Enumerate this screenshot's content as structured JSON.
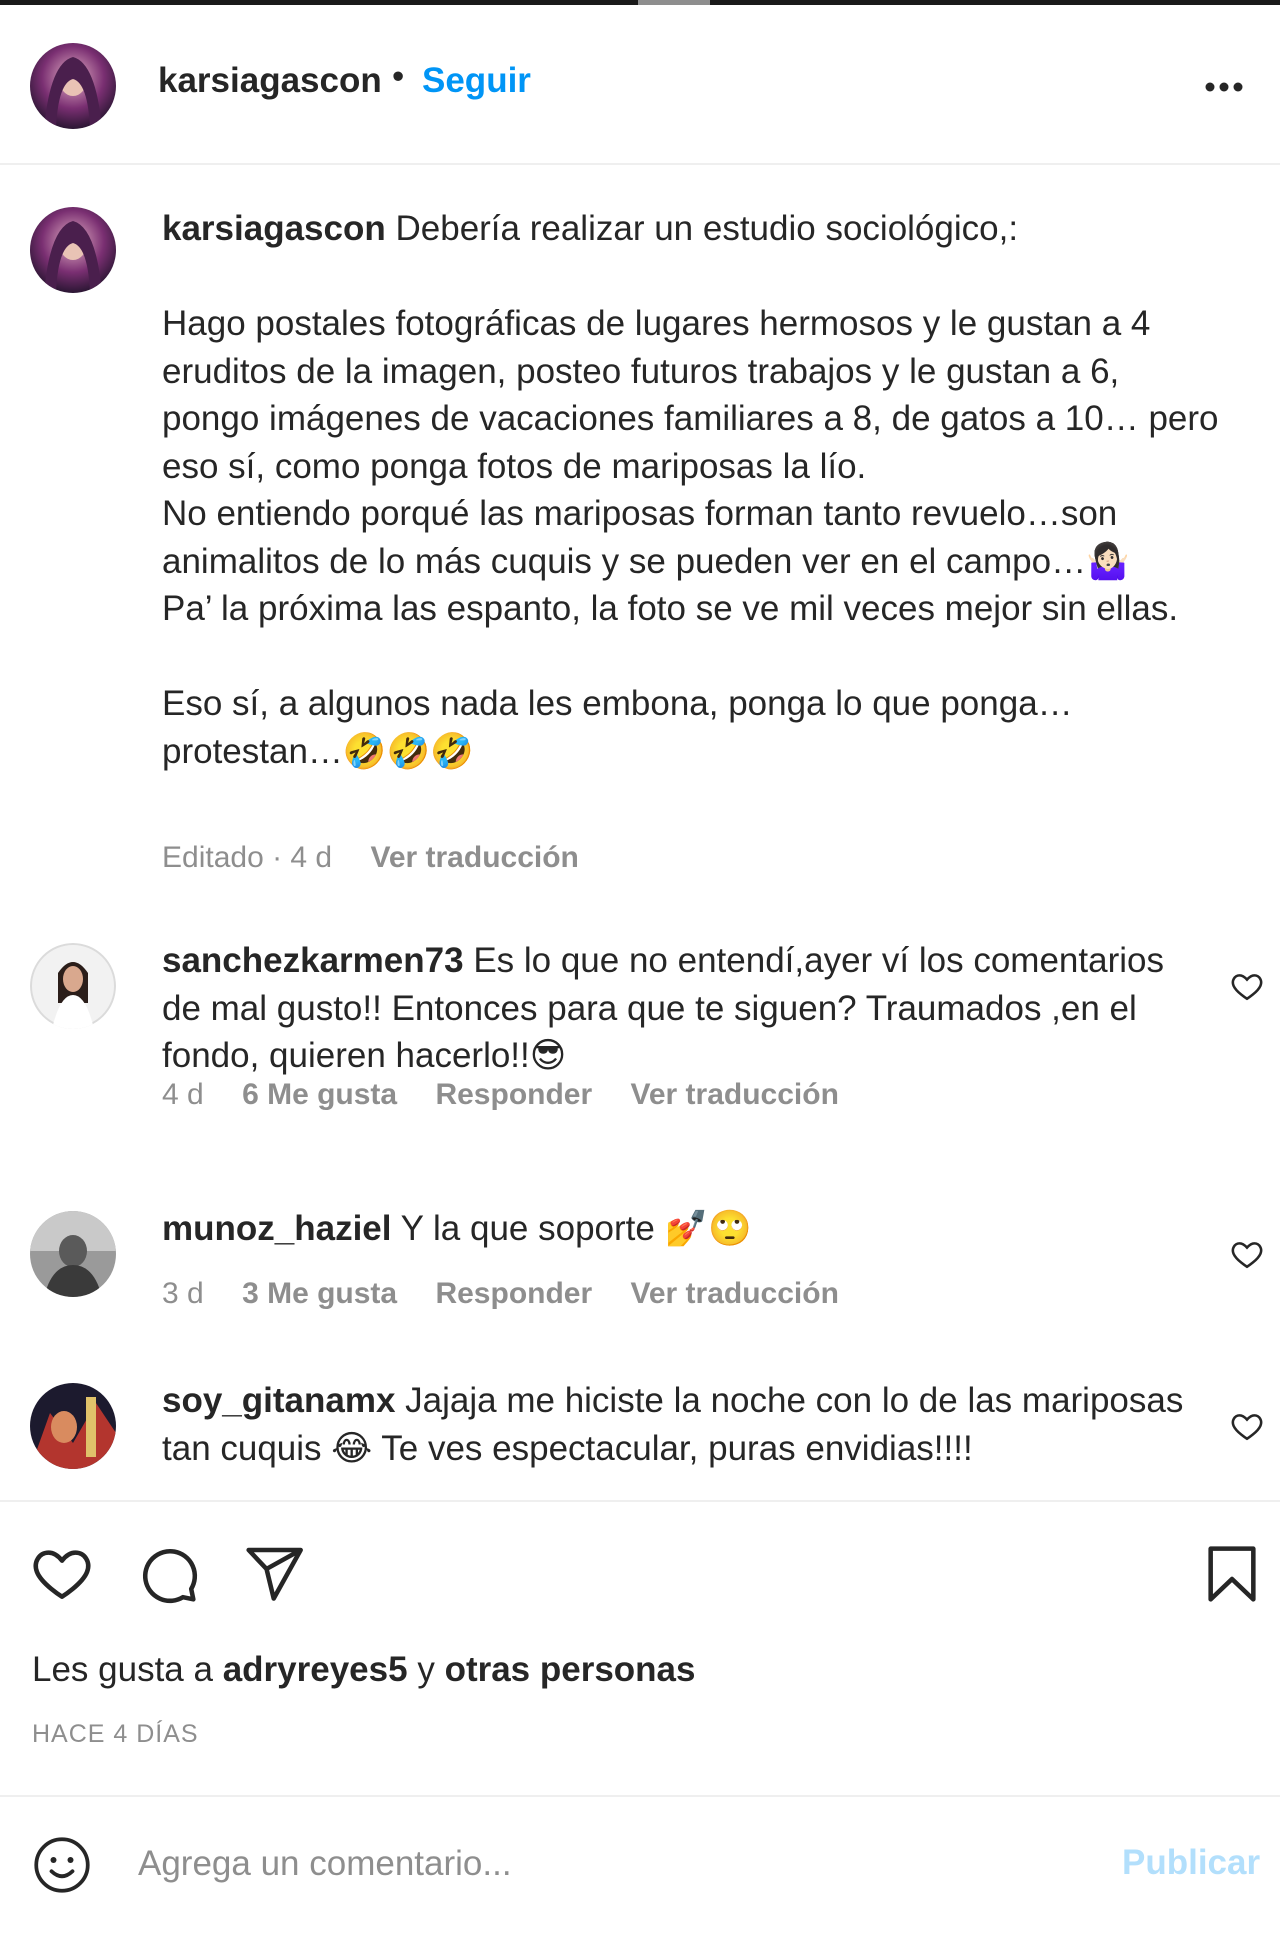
{
  "header": {
    "username": "karsiagascon",
    "separator": "•",
    "follow_label": "Seguir",
    "more_icon": "more-horizontal-icon"
  },
  "caption": {
    "username": "karsiagascon",
    "text": "Debería realizar un estudio sociológico,:\n\nHago postales fotográficas de lugares hermosos y le gustan a 4 eruditos de la imagen, posteo futuros trabajos y le gustan a 6, pongo imágenes de vacaciones familiares a 8, de gatos a 10… pero eso sí, como ponga fotos de mariposas la lío.\nNo entiendo porqué las mariposas forman tanto revuelo…son animalitos de lo más cuquis y se pueden ver en el campo…🤷🏻‍♀️\nPa’ la próxima las espanto, la foto se ve mil veces mejor sin ellas.\n\nEso sí, a algunos nada les embona, ponga lo que ponga… protestan…🤣🤣🤣",
    "edited": "Editado · 4 d",
    "translate": "Ver traducción"
  },
  "comments": [
    {
      "username": "sanchezkarmen73",
      "text": "Es lo que no entendí,ayer ví los comentarios de mal gusto!! Entonces para que te siguen? Traumados ,en el fondo, quieren hacerlo!!😎",
      "time": "4 d",
      "likes": "6 Me gusta",
      "reply": "Responder",
      "translate": "Ver traducción"
    },
    {
      "username": "munoz_haziel",
      "text": "Y la que soporte 💅🙄",
      "time": "3 d",
      "likes": "3 Me gusta",
      "reply": "Responder",
      "translate": "Ver traducción"
    },
    {
      "username": "soy_gitanamx",
      "text": "Jajaja me hiciste la noche con lo de las mariposas tan cuquis 😂 Te ves espectacular, puras envidias!!!!"
    }
  ],
  "actions": {
    "like_icon": "heart-icon",
    "comment_icon": "comment-icon",
    "share_icon": "paper-plane-icon",
    "save_icon": "bookmark-icon"
  },
  "likes": {
    "prefix": "Les gusta a",
    "user": "adryreyes5",
    "conj": "y",
    "others": "otras personas"
  },
  "timestamp": "HACE 4 DÍAS",
  "comment_box": {
    "placeholder": "Agrega un comentario...",
    "publish_label": "Publicar",
    "emoji_icon": "smiley-icon"
  },
  "colors": {
    "accent": "#0095f6",
    "publish_disabled": "#b2dffc",
    "secondary_text": "#8e8e8e",
    "primary_text": "#262626"
  }
}
